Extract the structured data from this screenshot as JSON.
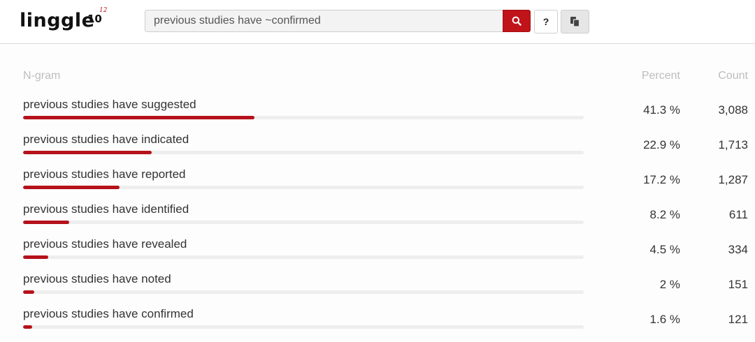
{
  "header": {
    "logo_text": "linggle",
    "logo_sup": "10",
    "logo_sup2": "12",
    "search_value": "previous studies have ~confirmed",
    "help_label": "?",
    "icons": {
      "search": "search-icon",
      "copy": "copy-icon"
    },
    "accent_color": "#c0141a"
  },
  "table": {
    "columns": {
      "ngram": "N-gram",
      "percent": "Percent",
      "count": "Count"
    },
    "rows": [
      {
        "ngram": "previous studies have suggested",
        "percent": "41.3 %",
        "count": "3,088",
        "fraction": 0.413
      },
      {
        "ngram": "previous studies have indicated",
        "percent": "22.9 %",
        "count": "1,713",
        "fraction": 0.229
      },
      {
        "ngram": "previous studies have reported",
        "percent": "17.2 %",
        "count": "1,287",
        "fraction": 0.172
      },
      {
        "ngram": "previous studies have identified",
        "percent": "8.2 %",
        "count": "611",
        "fraction": 0.082
      },
      {
        "ngram": "previous studies have revealed",
        "percent": "4.5 %",
        "count": "334",
        "fraction": 0.045
      },
      {
        "ngram": "previous studies have noted",
        "percent": "2 %",
        "count": "151",
        "fraction": 0.02
      },
      {
        "ngram": "previous studies have confirmed",
        "percent": "1.6 %",
        "count": "121",
        "fraction": 0.016
      }
    ]
  }
}
